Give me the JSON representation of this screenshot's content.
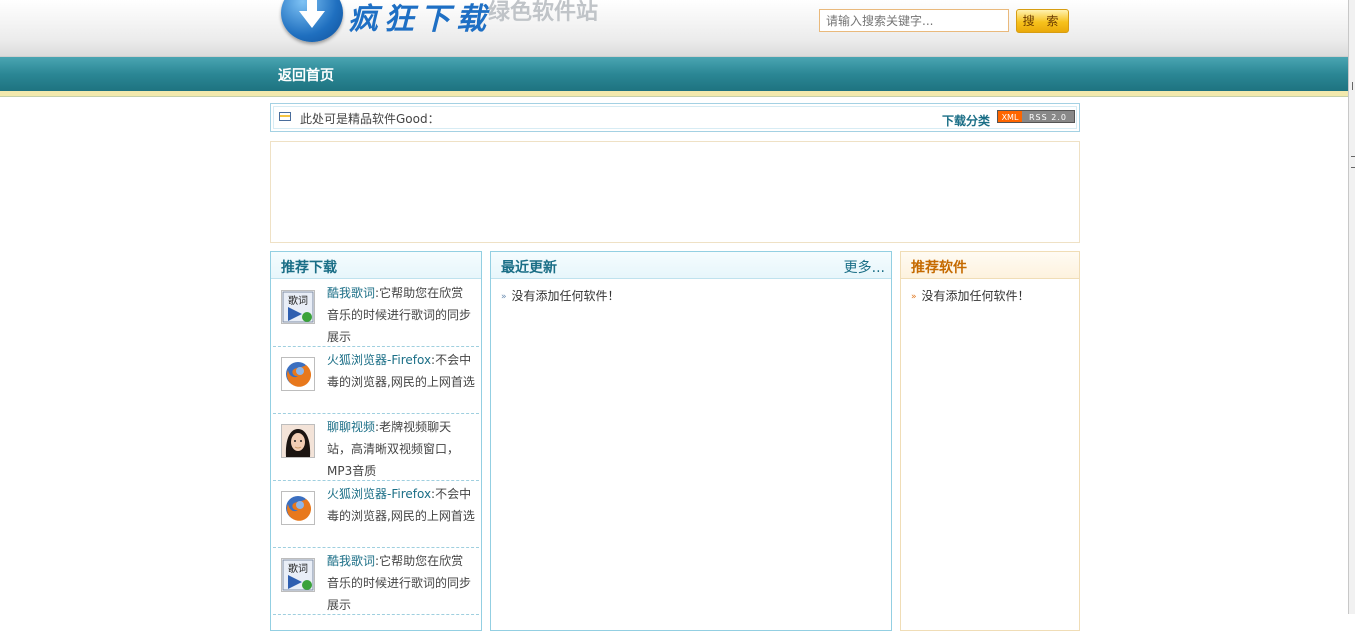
{
  "header": {
    "logo_main": "疯狂下载",
    "logo_sub": "绿色软件站",
    "search_placeholder": "请输入搜索关键字...",
    "search_button": "搜 索"
  },
  "nav": {
    "home": "返回首页"
  },
  "notice": {
    "text": "此处可是精品软件Good：",
    "category_link": "下载分类",
    "rss_xml": "XML",
    "rss_version": "RSS 2.0"
  },
  "recommend_downloads": {
    "title": "推荐下载",
    "items": [
      {
        "name": "酷我歌词",
        "desc": "它帮助您在欣赏音乐的时候进行歌词的同步展示",
        "icon": "lyrics-icon"
      },
      {
        "name": "火狐浏览器-Firefox",
        "desc": "不会中毒的浏览器,网民的上网首选",
        "icon": "firefox-icon"
      },
      {
        "name": "聊聊视频",
        "desc": "老牌视频聊天站，高清晰双视频窗口，MP3音质",
        "icon": "video-chat-avatar"
      },
      {
        "name": "火狐浏览器-Firefox",
        "desc": "不会中毒的浏览器,网民的上网首选",
        "icon": "firefox-icon"
      },
      {
        "name": "酷我歌词",
        "desc": "它帮助您在欣赏音乐的时候进行歌词的同步展示",
        "icon": "lyrics-icon"
      }
    ]
  },
  "latest_updates": {
    "title": "最近更新",
    "more": "更多...",
    "empty": "没有添加任何软件！"
  },
  "recommend_software": {
    "title": "推荐软件",
    "empty": "没有添加任何软件！"
  },
  "colors": {
    "nav_bar": "#2b8795",
    "accent_teal": "#1a6e86",
    "accent_orange": "#c56a00",
    "search_button": "#f7c21c"
  }
}
